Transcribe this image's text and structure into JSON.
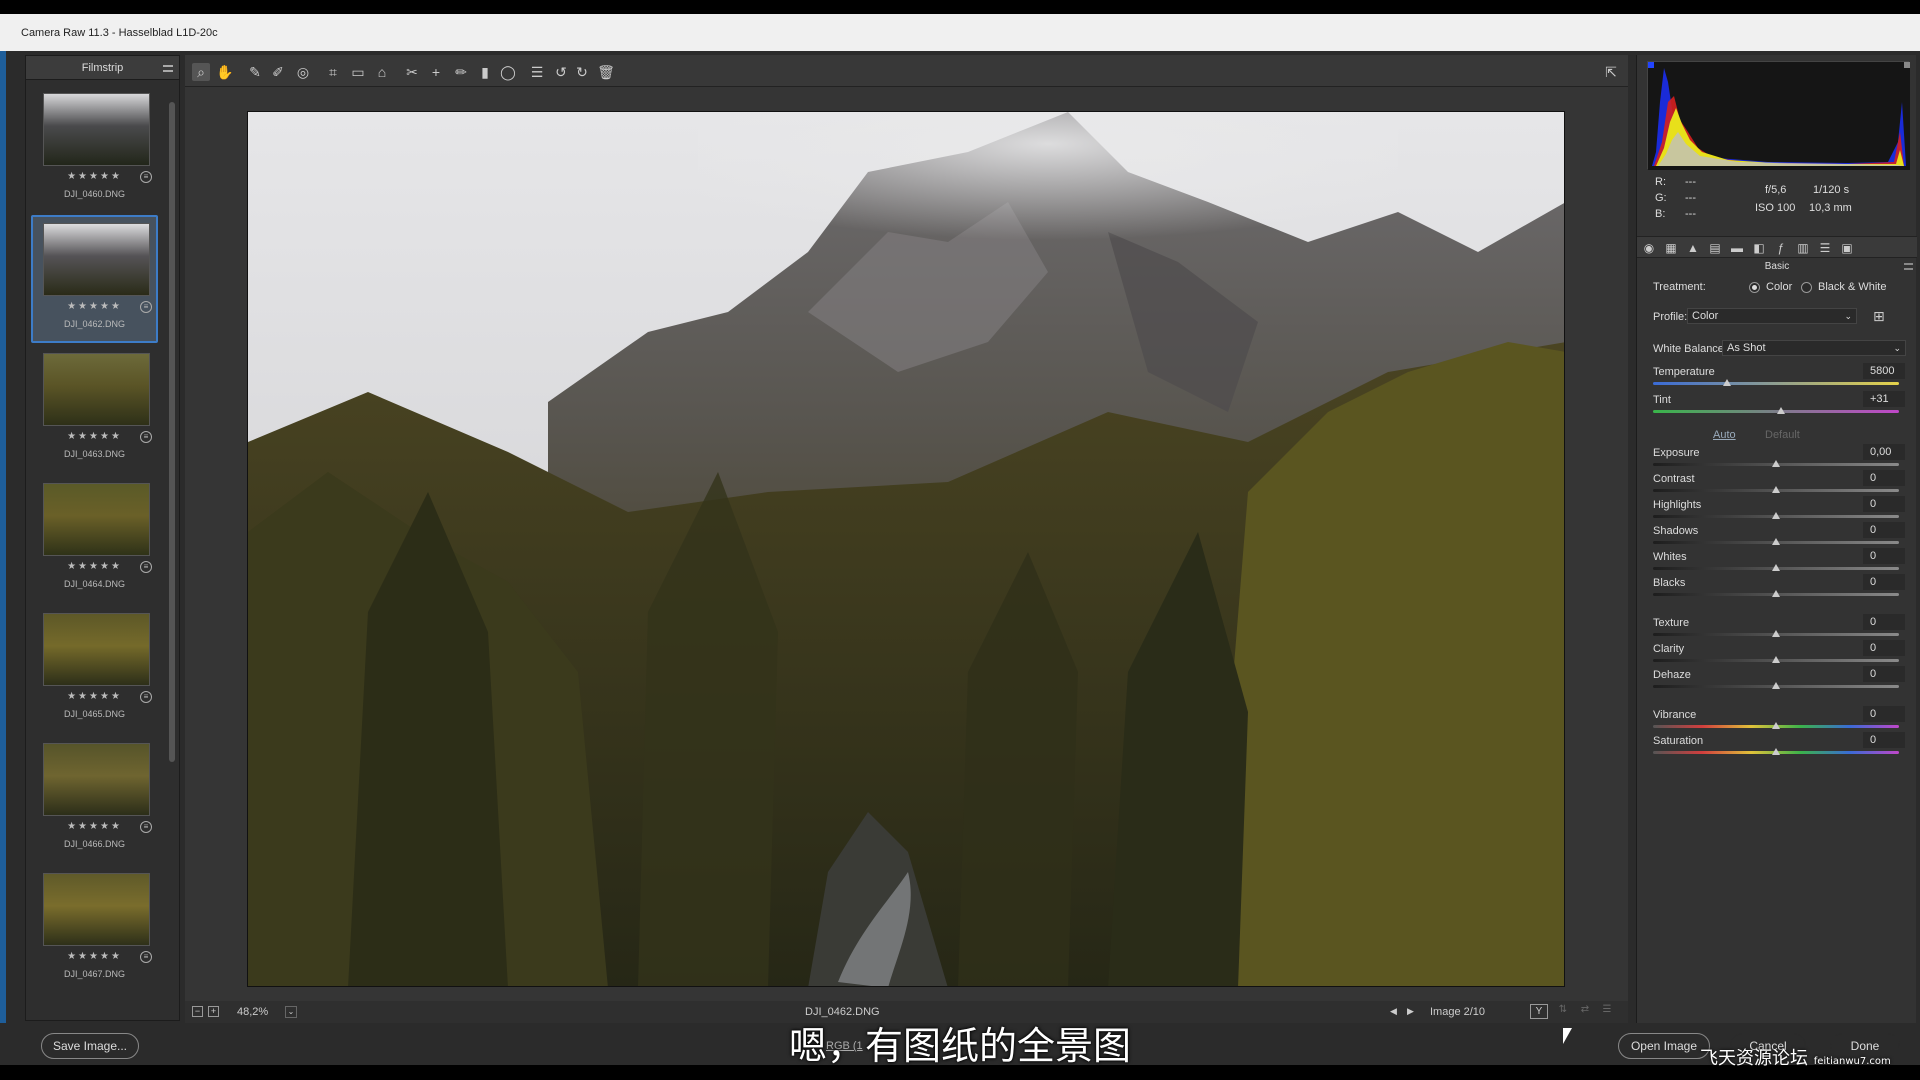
{
  "window": {
    "title": "Camera Raw 11.3  -  Hasselblad L1D-20c"
  },
  "filmstrip": {
    "title": "Filmstrip",
    "items": [
      {
        "name": "DJI_0460.DNG",
        "stars": "★★★★★",
        "selected": false
      },
      {
        "name": "DJI_0462.DNG",
        "stars": "★★★★★",
        "selected": true
      },
      {
        "name": "DJI_0463.DNG",
        "stars": "★★★★★",
        "selected": false
      },
      {
        "name": "DJI_0464.DNG",
        "stars": "★★★★★",
        "selected": false
      },
      {
        "name": "DJI_0465.DNG",
        "stars": "★★★★★",
        "selected": false
      },
      {
        "name": "DJI_0466.DNG",
        "stars": "★★★★★",
        "selected": false
      },
      {
        "name": "DJI_0467.DNG",
        "stars": "★★★★★",
        "selected": false
      }
    ]
  },
  "toolbar": {
    "tools": [
      "zoom-tool-icon",
      "hand-tool-icon",
      "white-balance-tool-icon",
      "color-sampler-tool-icon",
      "targeted-adjustment-tool-icon",
      "crop-tool-icon",
      "straighten-tool-icon",
      "transform-tool-icon",
      "spot-removal-tool-icon",
      "red-eye-tool-icon",
      "adjustment-brush-icon",
      "graduated-filter-icon",
      "radial-filter-icon",
      "presets-list-icon",
      "rotate-ccw-icon",
      "rotate-cw-icon",
      "trash-icon"
    ],
    "fullscreen_icon": "fullscreen-icon"
  },
  "status": {
    "zoom": "48,2%",
    "filename": "DJI_0462.DNG",
    "image_counter": "Image 2/10"
  },
  "histogram": {
    "r_label": "R:",
    "g_label": "G:",
    "b_label": "B:",
    "r_value": "---",
    "g_value": "---",
    "b_value": "---",
    "aperture": "f/5,6",
    "shutter": "1/120 s",
    "iso": "ISO 100",
    "focal": "10,3 mm"
  },
  "panel": {
    "section": "Basic",
    "treatment_label": "Treatment:",
    "treatment_color": "Color",
    "treatment_bw": "Black & White",
    "profile_label": "Profile:",
    "profile_value": "Color",
    "wb_label": "White Balance:",
    "wb_value": "As Shot",
    "auto": "Auto",
    "default": "Default",
    "sliders": [
      {
        "name": "Temperature",
        "value": "5800",
        "level": 0.3
      },
      {
        "name": "Tint",
        "value": "+31",
        "level": 0.52
      },
      {
        "name": "Exposure",
        "value": "0,00",
        "level": 0.5
      },
      {
        "name": "Contrast",
        "value": "0",
        "level": 0.5
      },
      {
        "name": "Highlights",
        "value": "0",
        "level": 0.5
      },
      {
        "name": "Shadows",
        "value": "0",
        "level": 0.5
      },
      {
        "name": "Whites",
        "value": "0",
        "level": 0.5
      },
      {
        "name": "Blacks",
        "value": "0",
        "level": 0.5
      },
      {
        "name": "Texture",
        "value": "0",
        "level": 0.5
      },
      {
        "name": "Clarity",
        "value": "0",
        "level": 0.5
      },
      {
        "name": "Dehaze",
        "value": "0",
        "level": 0.5
      },
      {
        "name": "Vibrance",
        "value": "0",
        "level": 0.5
      },
      {
        "name": "Saturation",
        "value": "0",
        "level": 0.5
      }
    ]
  },
  "buttons": {
    "save": "Save Image...",
    "open": "Open Image",
    "cancel": "Cancel",
    "done": "Done"
  },
  "workflow_partial": "RGB (1",
  "subtitle": "嗯，有图纸的全景图",
  "watermark": "飞天资源论坛",
  "watermark_url": "feitianwu7.com",
  "colors": {
    "accent": "#3d7cc7",
    "panel": "#333333",
    "background": "#2b2b2b"
  }
}
